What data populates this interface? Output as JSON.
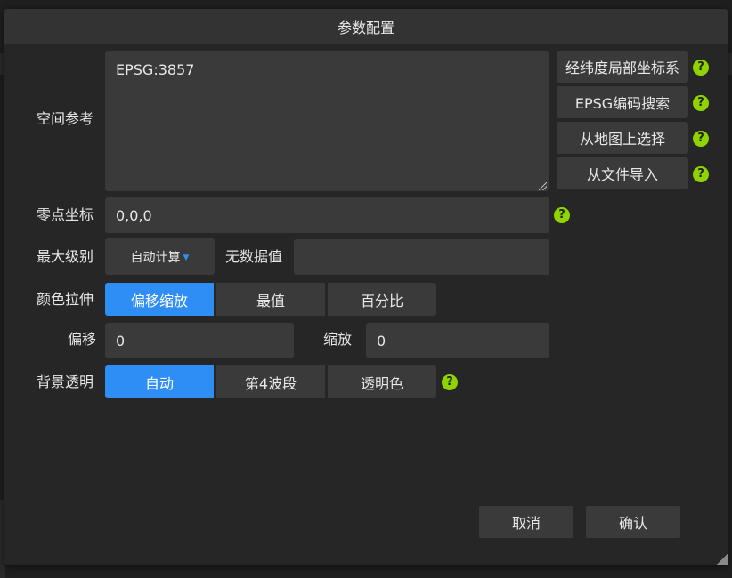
{
  "dialog": {
    "title": "参数配置"
  },
  "spatial_ref": {
    "label": "空间参考",
    "value": "EPSG:3857"
  },
  "side_buttons": [
    {
      "label": "经纬度局部坐标系"
    },
    {
      "label": "EPSG编码搜索"
    },
    {
      "label": "从地图上选择"
    },
    {
      "label": "从文件导入"
    }
  ],
  "origin": {
    "label": "零点坐标",
    "value": "0,0,0"
  },
  "max_level": {
    "label": "最大级别",
    "selected": "自动计算"
  },
  "nodata": {
    "label": "无数据值",
    "value": ""
  },
  "color_stretch": {
    "label": "颜色拉伸",
    "options": [
      "偏移缩放",
      "最值",
      "百分比"
    ],
    "selected": 0
  },
  "offset": {
    "label": "偏移",
    "value": "0"
  },
  "scale": {
    "label": "缩放",
    "value": "0"
  },
  "bg_transparent": {
    "label": "背景透明",
    "options": [
      "自动",
      "第4波段",
      "透明色"
    ],
    "selected": 0
  },
  "footer": {
    "cancel": "取消",
    "confirm": "确认"
  },
  "help_glyph": "?",
  "colors": {
    "accent": "#2e8ef5",
    "help": "#8fd400",
    "panel": "#262626",
    "field": "#3a3a3a"
  }
}
